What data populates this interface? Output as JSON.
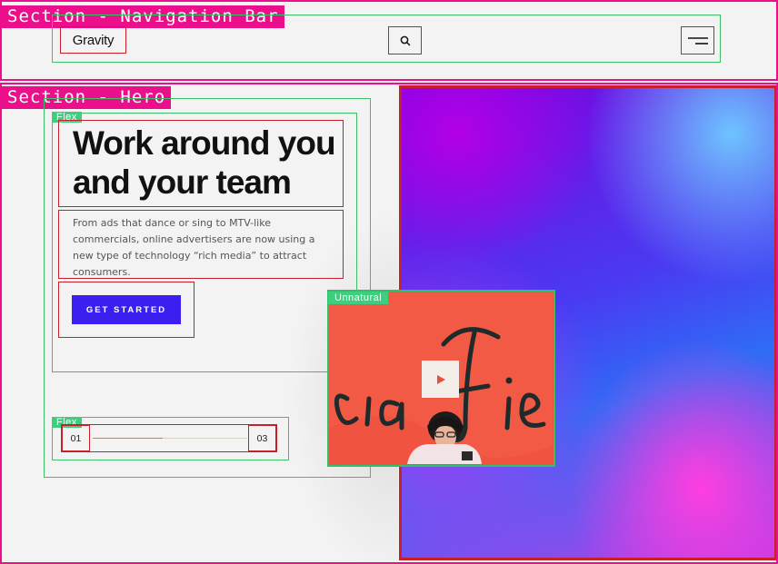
{
  "nav": {
    "section_label": "Section - Navigation Bar",
    "logo": "Gravity",
    "search_icon": "search-icon",
    "menu_icon": "hamburger-menu-icon"
  },
  "hero": {
    "section_label": "Section - Hero",
    "flex_tag": "Flex",
    "title_line1": "Work around you",
    "title_line2": "and your team",
    "description": "From ads that dance or sing to MTV-like commercials, online advertisers are now using a new type of technology “rich media” to attract consumers.",
    "cta_label": "GET STARTED",
    "pagination": {
      "flex_tag": "Flex",
      "current": "01",
      "total": "03",
      "progress": 0.45
    },
    "video": {
      "tag": "Unnatural",
      "wall_text": "cia Fie",
      "play_icon": "play-icon"
    }
  },
  "colors": {
    "section_pink": "#ec0f8b",
    "frame_green": "#3fbf6a",
    "frame_red": "#c7202a",
    "cta_blue": "#3b1ff0",
    "video_bg": "#f2533f"
  }
}
